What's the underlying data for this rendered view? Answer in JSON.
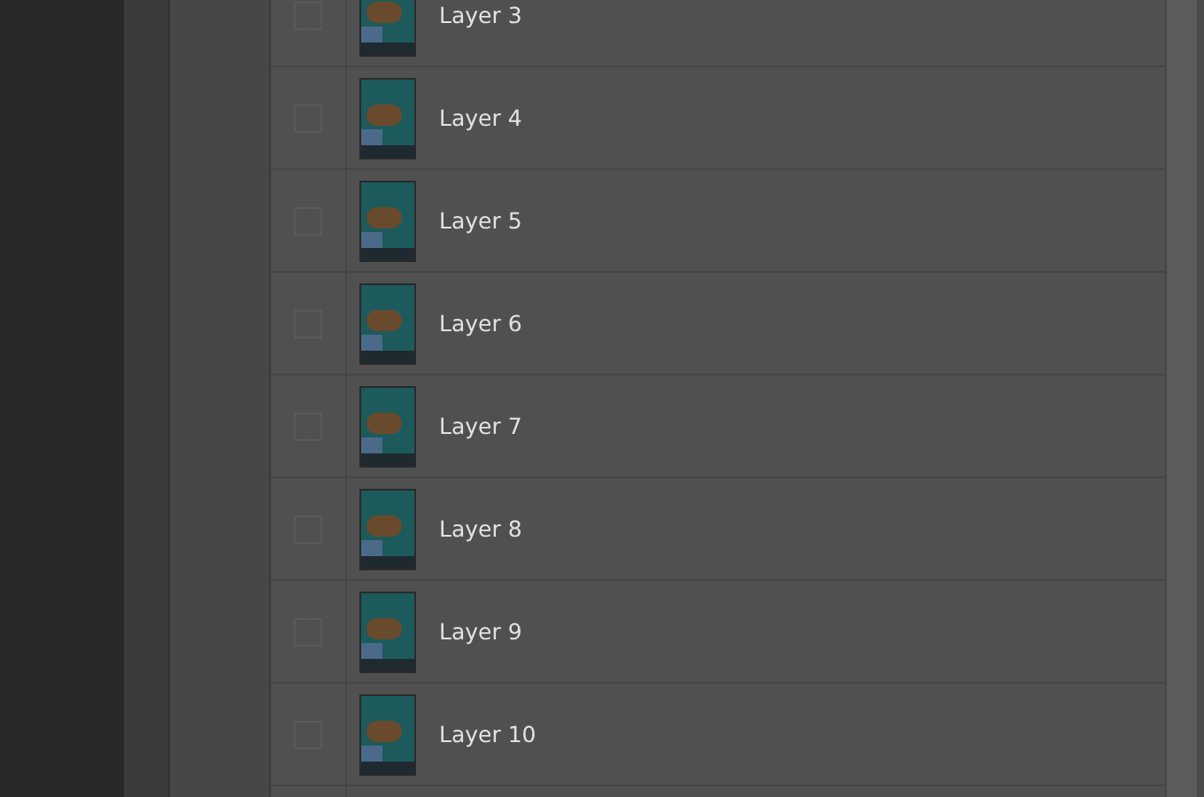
{
  "layers": [
    {
      "name": "Layer 3",
      "visible": false
    },
    {
      "name": "Layer 4",
      "visible": false
    },
    {
      "name": "Layer 5",
      "visible": false
    },
    {
      "name": "Layer 6",
      "visible": false
    },
    {
      "name": "Layer 7",
      "visible": false
    },
    {
      "name": "Layer 8",
      "visible": false
    },
    {
      "name": "Layer 9",
      "visible": false
    },
    {
      "name": "Layer 10",
      "visible": false
    }
  ]
}
